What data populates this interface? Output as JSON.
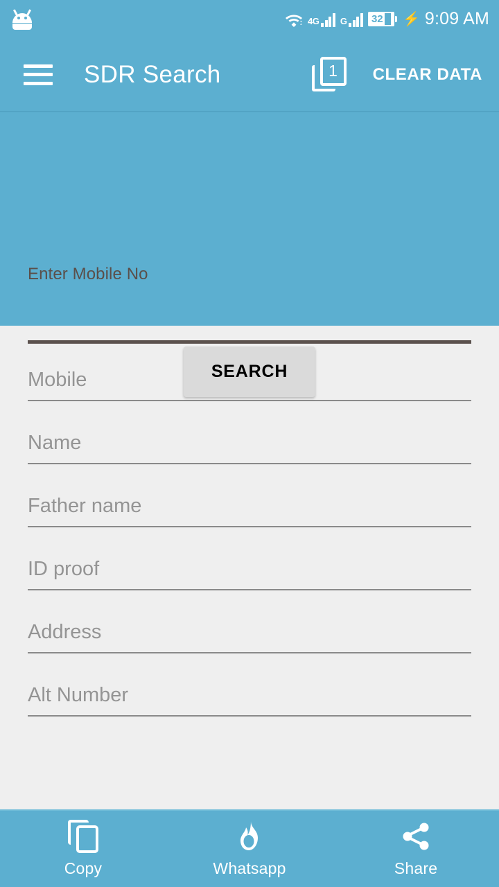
{
  "status_bar": {
    "notification_icon": "android-robot-icon",
    "wifi_icon": "wifi-icon",
    "network_label_1": "4G",
    "network_label_2": "G",
    "signal_icon_1": "signal-bars-icon",
    "signal_icon_2": "signal-bars-icon",
    "battery_level": "32",
    "charging_icon": "charging-bolt-icon",
    "time": "9:09 AM"
  },
  "app_bar": {
    "menu_icon": "hamburger-menu-icon",
    "title": "SDR Search",
    "tabs_icon": "tabs-icon",
    "tabs_count": "1",
    "clear_data_label": "CLEAR DATA"
  },
  "search_panel": {
    "label": "Enter Mobile No",
    "input_value": "",
    "input_placeholder": "",
    "search_button_label": "SEARCH"
  },
  "result_form": {
    "fields": [
      {
        "name": "mobile",
        "placeholder": "Mobile",
        "value": ""
      },
      {
        "name": "name",
        "placeholder": "Name",
        "value": ""
      },
      {
        "name": "father-name",
        "placeholder": "Father name",
        "value": ""
      },
      {
        "name": "id-proof",
        "placeholder": "ID proof",
        "value": ""
      },
      {
        "name": "address",
        "placeholder": "Address",
        "value": ""
      },
      {
        "name": "alt-number",
        "placeholder": "Alt Number",
        "value": ""
      }
    ]
  },
  "bottom_bar": {
    "items": [
      {
        "icon": "copy-icon",
        "label": "Copy"
      },
      {
        "icon": "whatsapp-icon",
        "label": "Whatsapp"
      },
      {
        "icon": "share-icon",
        "label": "Share"
      }
    ]
  },
  "colors": {
    "primary_blue": "#5cafd0",
    "appbar_divider": "#52a3c4",
    "form_background": "#efefef",
    "search_underline": "#5b514d",
    "search_label_text": "#5a4f4a",
    "button_gray": "#dadada",
    "placeholder_gray": "#949494",
    "field_underline": "#8a8a8a",
    "white": "#ffffff"
  }
}
